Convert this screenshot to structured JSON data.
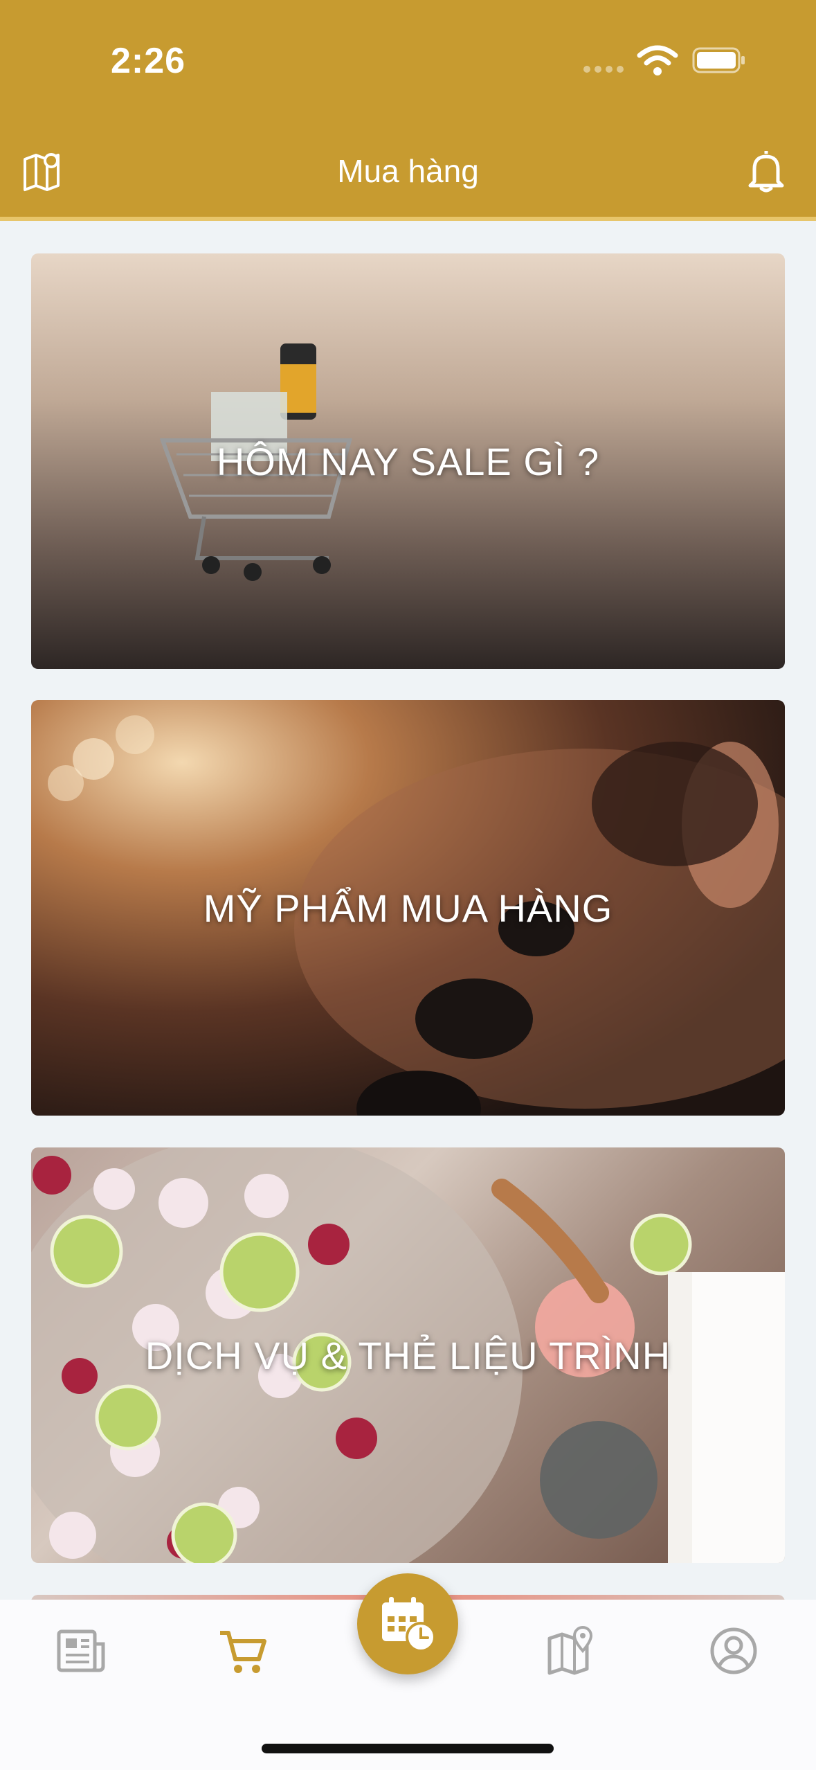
{
  "status_bar": {
    "time": "2:26"
  },
  "header": {
    "title": "Mua hàng"
  },
  "cards": [
    {
      "label": "HÔM NAY SALE GÌ ?"
    },
    {
      "label": "MỸ PHẨM MUA HÀNG"
    },
    {
      "label": "DỊCH VỤ & THẺ LIỆU TRÌNH"
    }
  ],
  "tabbar": {
    "items": [
      {
        "icon": "newspaper-icon",
        "active": false
      },
      {
        "icon": "cart-icon",
        "active": true
      },
      {
        "icon": "calendar-clock-icon",
        "active": false,
        "center": true
      },
      {
        "icon": "map-pin-icon",
        "active": false
      },
      {
        "icon": "user-icon",
        "active": false
      }
    ]
  },
  "colors": {
    "brand": "#c79b30",
    "inactive_icon": "#a8a8a8",
    "background": "#eff3f6"
  }
}
